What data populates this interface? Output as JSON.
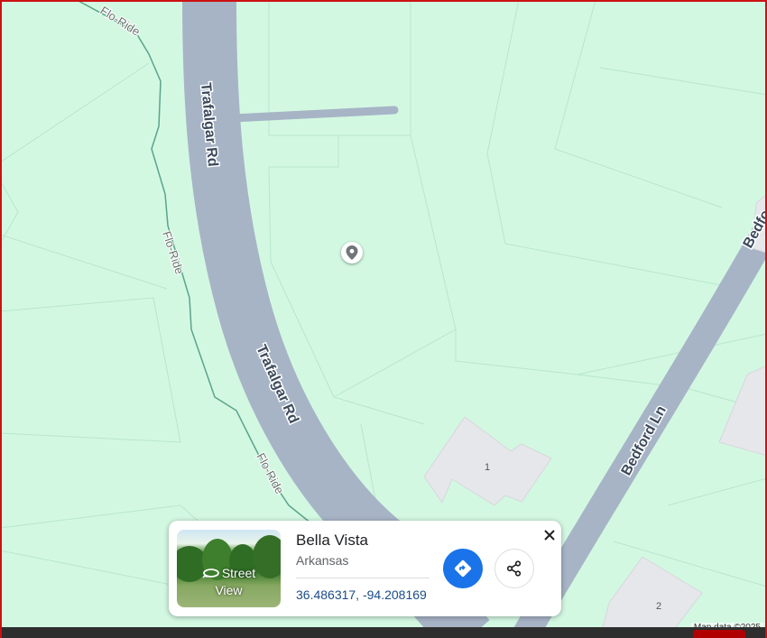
{
  "map": {
    "background_color": "#d3f8e2",
    "road_color": "#a7b4c6",
    "path_color": "#5aa48a",
    "building_color": "#e6e7ea",
    "labels": {
      "trafalgar_upper": "Trafalgar Rd",
      "trafalgar_lower": "Trafalgar Rd",
      "bedford_main": "Bedford Ln",
      "bedford_top": "Bedfo",
      "flo_ride_top": "Flo-Ride",
      "flo_ride_mid": "Flo-Ride",
      "flo_ride_low": "Flo-Ride",
      "house_1": "1",
      "house_2": "2"
    },
    "pin_icon": "location-pin-icon"
  },
  "place_card": {
    "title": "Bella Vista",
    "subtitle": "Arkansas",
    "coordinates": "36.486317, -94.208169",
    "street_view_label_line1": "Street",
    "street_view_label_line2": "View",
    "directions_icon": "directions-icon",
    "share_icon": "share-icon",
    "close_icon": "close-icon",
    "accent_color": "#1a73e8"
  },
  "attribution": "Map data ©2025"
}
